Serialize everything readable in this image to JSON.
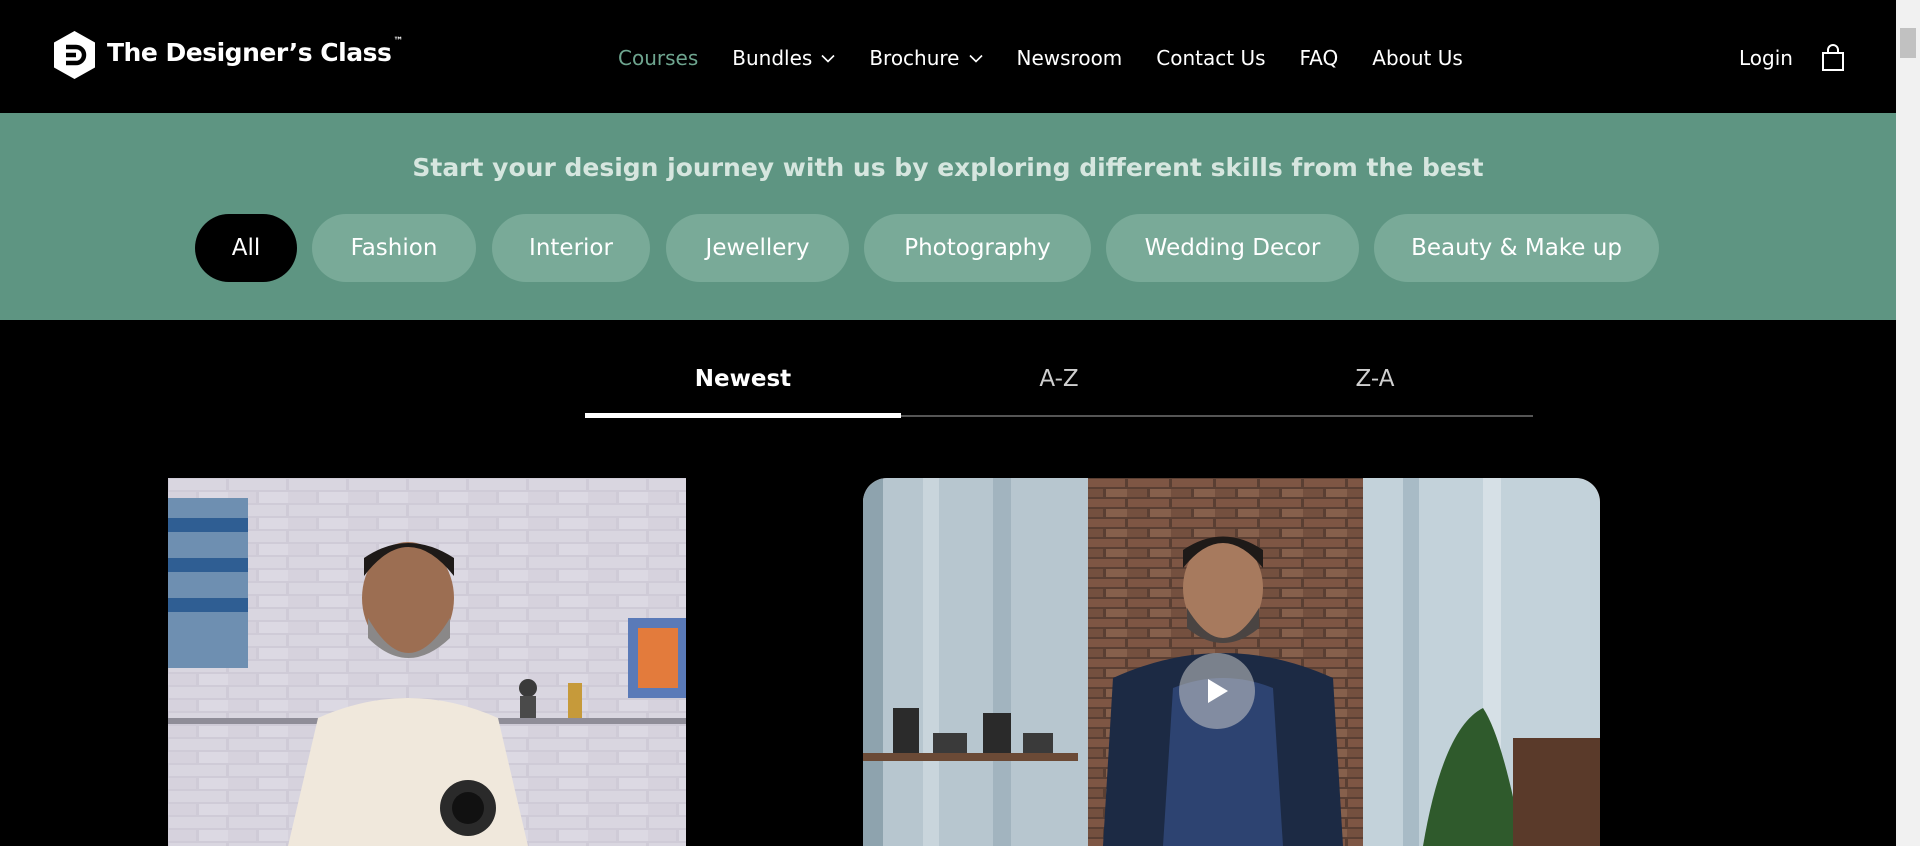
{
  "brand": {
    "name": "The Designer’s Class",
    "tm": "™",
    "icon": "designers-class-logo-icon"
  },
  "nav": {
    "items": [
      {
        "label": "Courses",
        "active": true
      },
      {
        "label": "Bundles",
        "dropdown": true
      },
      {
        "label": "Brochure",
        "dropdown": true
      },
      {
        "label": "Newsroom"
      },
      {
        "label": "Contact Us"
      },
      {
        "label": "FAQ"
      },
      {
        "label": "About Us"
      }
    ],
    "login": "Login",
    "cart_icon": "shopping-bag-icon"
  },
  "categories": {
    "heading": "Start your design journey with us by exploring different skills from the best",
    "chips": [
      "All",
      "Fashion",
      "Interior",
      "Jewellery",
      "Photography",
      "Wedding Decor",
      "Beauty & Make up"
    ],
    "selected": "All"
  },
  "sort": {
    "tabs": [
      "Newest",
      "A-Z",
      "Z-A"
    ],
    "selected": "Newest"
  },
  "courses": {
    "cards": [
      {
        "image": "instructor-with-camera-photo"
      },
      {
        "image": "instructor-video-thumbnail",
        "play_icon": "play-icon"
      }
    ]
  },
  "colors": {
    "accent": "#5e9582",
    "chip": "#79aa98",
    "active_nav": "#6ea58f",
    "background": "#000000"
  }
}
